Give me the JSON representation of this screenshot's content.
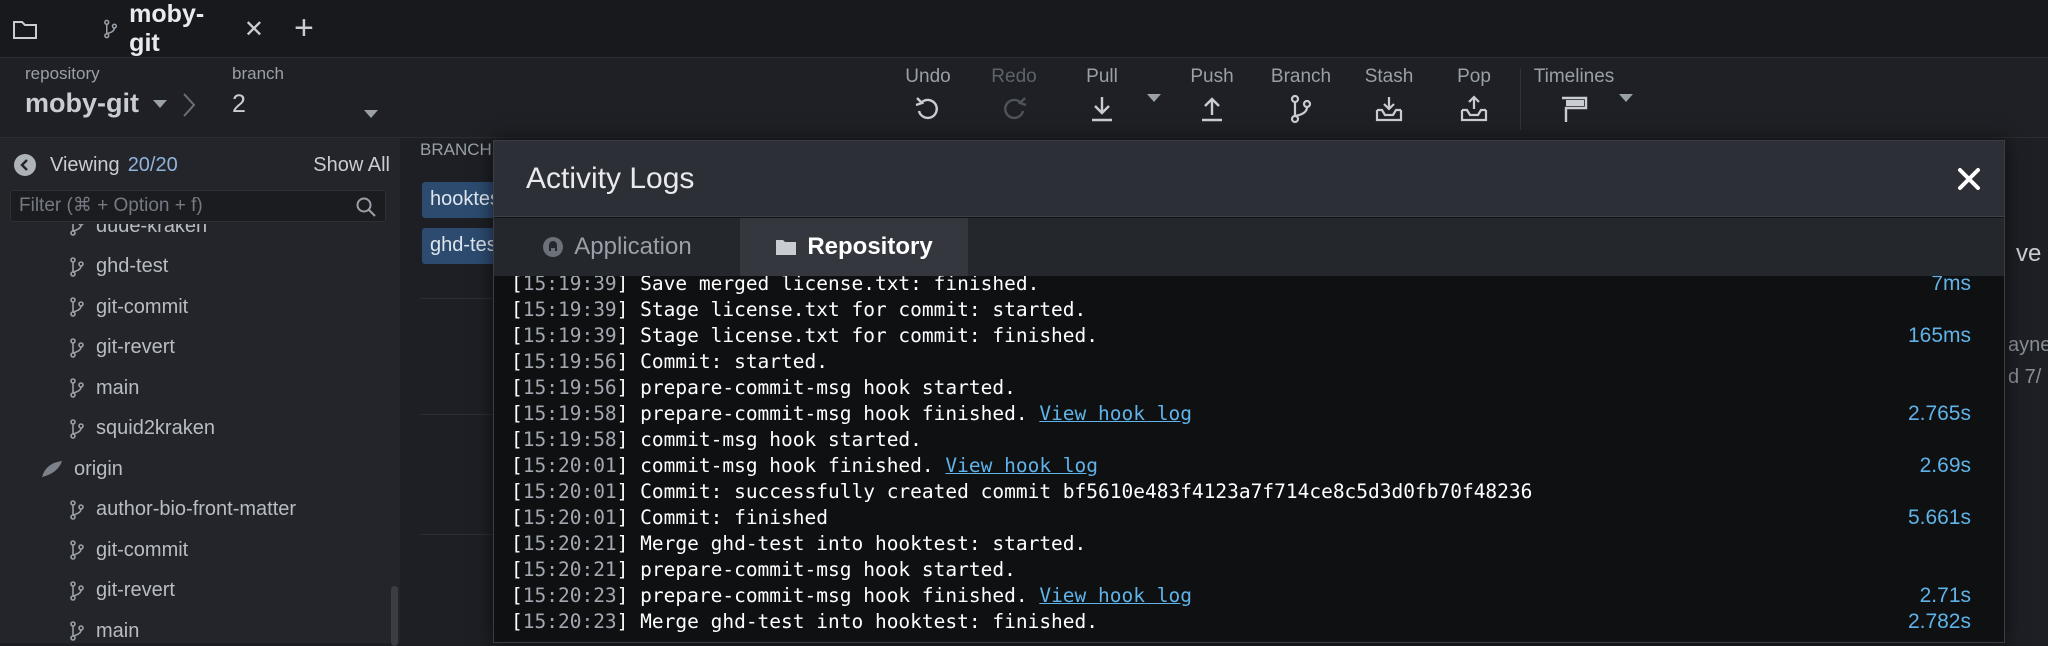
{
  "tabbar": {
    "tab_label": "moby-git",
    "close_glyph": "✕",
    "add_glyph": "+"
  },
  "toolbar": {
    "repository_label": "repository",
    "repository_name": "moby-git",
    "branch_label": "branch",
    "branch_value": "2",
    "buttons": [
      {
        "label": "Undo",
        "icon": "undo-icon",
        "enabled": true
      },
      {
        "label": "Redo",
        "icon": "redo-icon",
        "enabled": false
      },
      {
        "label": "Pull",
        "icon": "pull-icon",
        "enabled": true
      },
      {
        "label": "Push",
        "icon": "push-icon",
        "enabled": true
      },
      {
        "label": "Branch",
        "icon": "branch-icon",
        "enabled": true
      },
      {
        "label": "Stash",
        "icon": "stash-icon",
        "enabled": true
      },
      {
        "label": "Pop",
        "icon": "pop-icon",
        "enabled": true
      },
      {
        "label": "Timelines",
        "icon": "timelines-icon",
        "enabled": true
      }
    ]
  },
  "sidebar": {
    "viewing_label": "Viewing",
    "viewing_count": "20/20",
    "show_all": "Show All",
    "filter_placeholder": "Filter (⌘ + Option + f)",
    "tree": [
      {
        "label": "dude-kraken",
        "kind": "branch"
      },
      {
        "label": "ghd-test",
        "kind": "branch"
      },
      {
        "label": "git-commit",
        "kind": "branch"
      },
      {
        "label": "git-revert",
        "kind": "branch"
      },
      {
        "label": "main",
        "kind": "branch"
      },
      {
        "label": "squid2kraken",
        "kind": "branch"
      },
      {
        "label": "origin",
        "kind": "remote"
      },
      {
        "label": "author-bio-front-matter",
        "kind": "branch"
      },
      {
        "label": "git-commit",
        "kind": "branch"
      },
      {
        "label": "git-revert",
        "kind": "branch"
      },
      {
        "label": "main",
        "kind": "branch"
      }
    ]
  },
  "graph": {
    "header": "BRANCH",
    "chips": [
      "hooktest",
      "ghd-test"
    ],
    "peek_texts": [
      "ve",
      "ayne",
      "d 7/"
    ]
  },
  "modal": {
    "title": "Activity Logs",
    "tabs": [
      {
        "label": "Application",
        "active": false
      },
      {
        "label": "Repository",
        "active": true
      }
    ],
    "logs": [
      {
        "time": "15:19:39",
        "text": "Save merged license.txt: finished.",
        "link": "",
        "duration": "7ms"
      },
      {
        "time": "15:19:39",
        "text": "Stage license.txt for commit: started.",
        "link": "",
        "duration": ""
      },
      {
        "time": "15:19:39",
        "text": "Stage license.txt for commit: finished.",
        "link": "",
        "duration": "165ms"
      },
      {
        "time": "15:19:56",
        "text": "Commit: started.",
        "link": "",
        "duration": ""
      },
      {
        "time": "15:19:56",
        "text": "prepare-commit-msg hook started.",
        "link": "",
        "duration": ""
      },
      {
        "time": "15:19:58",
        "text": "prepare-commit-msg hook finished.",
        "link": "View hook log",
        "duration": "2.765s"
      },
      {
        "time": "15:19:58",
        "text": "commit-msg hook started.",
        "link": "",
        "duration": ""
      },
      {
        "time": "15:20:01",
        "text": "commit-msg hook finished.",
        "link": "View hook log",
        "duration": "2.69s"
      },
      {
        "time": "15:20:01",
        "text": "Commit: successfully created commit bf5610e483f4123a7f714ce8c5d3d0fb70f48236",
        "link": "",
        "duration": ""
      },
      {
        "time": "15:20:01",
        "text": "Commit: finished",
        "link": "",
        "duration": "5.661s"
      },
      {
        "time": "15:20:21",
        "text": "Merge ghd-test into hooktest: started.",
        "link": "",
        "duration": ""
      },
      {
        "time": "15:20:21",
        "text": "prepare-commit-msg hook started.",
        "link": "",
        "duration": ""
      },
      {
        "time": "15:20:23",
        "text": "prepare-commit-msg hook finished.",
        "link": "View hook log",
        "duration": "2.71s"
      },
      {
        "time": "15:20:23",
        "text": "Merge ghd-test into hooktest: finished.",
        "link": "",
        "duration": "2.782s"
      }
    ]
  },
  "colors": {
    "accent_blue": "#5fb3e8",
    "modal_bg": "#111214",
    "sidebar_bg": "#23252b"
  }
}
